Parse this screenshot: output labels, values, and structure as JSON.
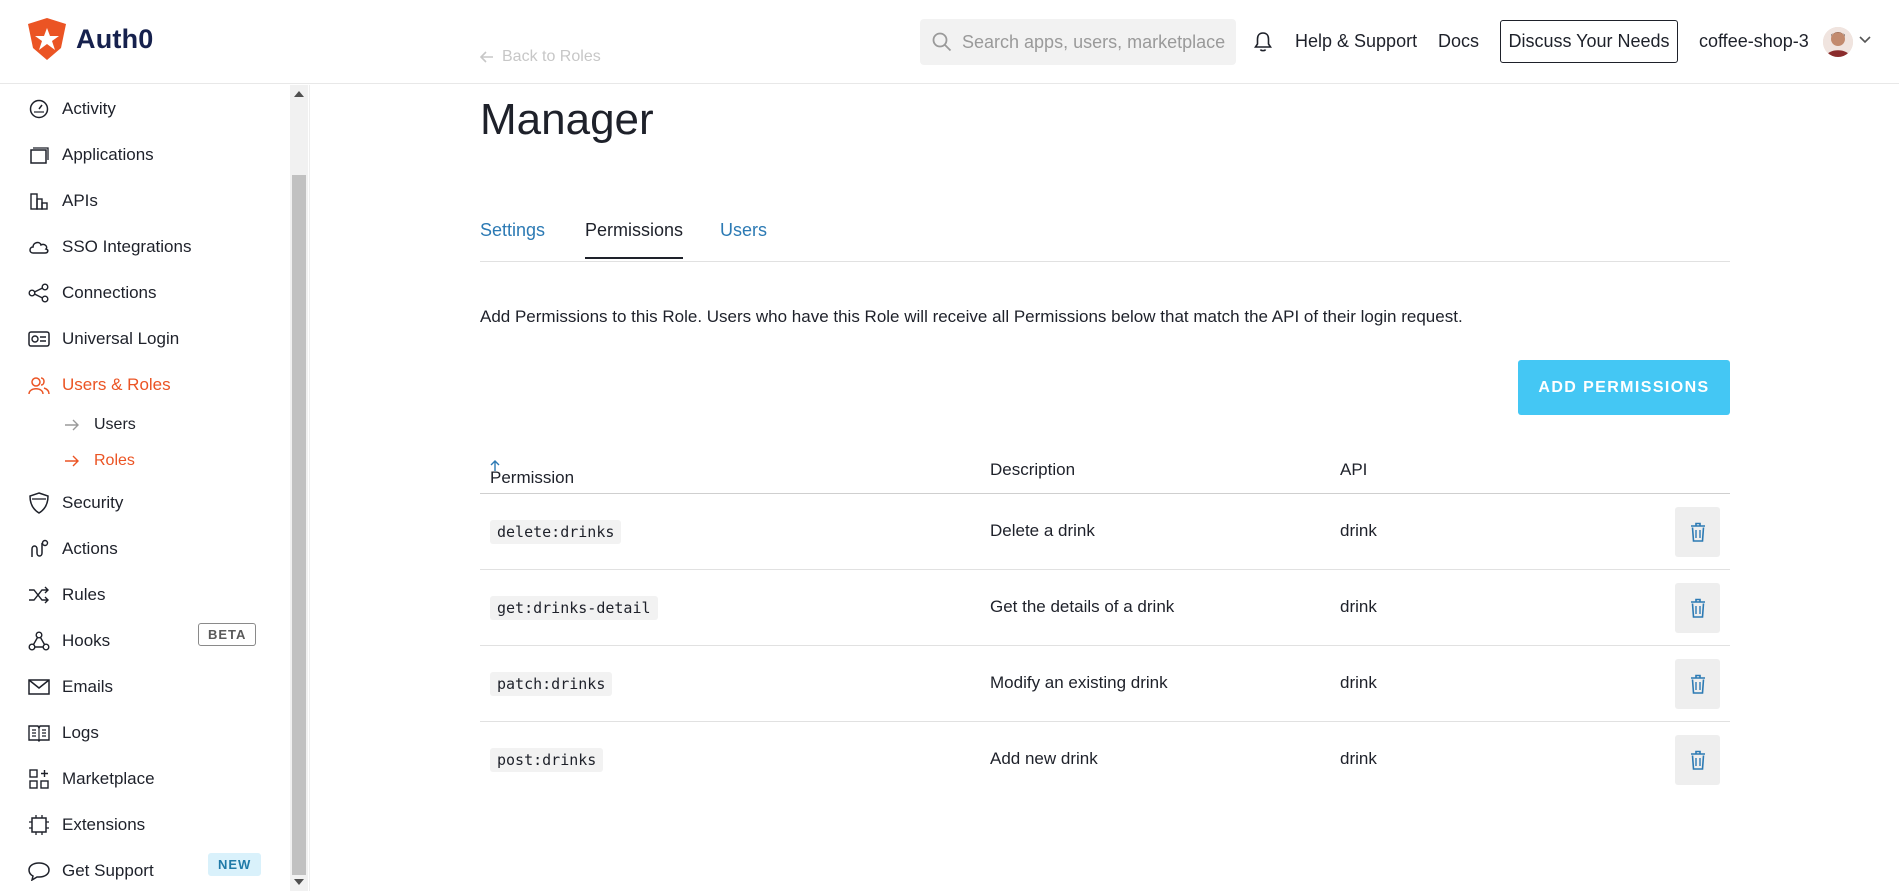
{
  "brand": {
    "name": "Auth0",
    "accent": "#eb5424",
    "link": "#2c7ab4",
    "button": "#44c7f4"
  },
  "header": {
    "search_placeholder": "Search apps, users, marketplace",
    "help": "Help & Support",
    "docs": "Docs",
    "discuss": "Discuss Your Needs",
    "tenant": "coffee-shop-3"
  },
  "back_link": "Back to Roles",
  "sidebar": {
    "items": [
      {
        "label": "Activity",
        "icon": "activity-gauge-icon"
      },
      {
        "label": "Applications",
        "icon": "applications-icon"
      },
      {
        "label": "APIs",
        "icon": "apis-icon"
      },
      {
        "label": "SSO Integrations",
        "icon": "cloud-icon"
      },
      {
        "label": "Connections",
        "icon": "connections-icon"
      },
      {
        "label": "Universal Login",
        "icon": "login-card-icon"
      },
      {
        "label": "Users & Roles",
        "icon": "users-icon",
        "active": true
      },
      {
        "label": "Security",
        "icon": "shield-icon"
      },
      {
        "label": "Actions",
        "icon": "actions-icon",
        "badge": "BETA"
      },
      {
        "label": "Rules",
        "icon": "rules-shuffle-icon"
      },
      {
        "label": "Hooks",
        "icon": "hooks-icon"
      },
      {
        "label": "Emails",
        "icon": "envelope-icon"
      },
      {
        "label": "Logs",
        "icon": "logs-book-icon"
      },
      {
        "label": "Marketplace",
        "icon": "marketplace-grid-icon",
        "badge": "NEW"
      },
      {
        "label": "Extensions",
        "icon": "chip-icon"
      },
      {
        "label": "Get Support",
        "icon": "chat-bubble-icon"
      }
    ],
    "subitems": [
      {
        "label": "Users"
      },
      {
        "label": "Roles",
        "active": true
      }
    ]
  },
  "role": {
    "title": "Manager",
    "tabs": [
      "Settings",
      "Permissions",
      "Users"
    ],
    "active_tab": "Permissions",
    "description": "Add Permissions to this Role. Users who have this Role will receive all Permissions below that match the API of their login request.",
    "add_button": "ADD PERMISSIONS"
  },
  "table": {
    "columns": [
      "Permission",
      "Description",
      "API"
    ],
    "rows": [
      {
        "permission": "delete:drinks",
        "description": "Delete a drink",
        "api": "drink"
      },
      {
        "permission": "get:drinks-detail",
        "description": "Get the details of a drink",
        "api": "drink"
      },
      {
        "permission": "patch:drinks",
        "description": "Modify an existing drink",
        "api": "drink"
      },
      {
        "permission": "post:drinks",
        "description": "Add new drink",
        "api": "drink"
      }
    ]
  }
}
